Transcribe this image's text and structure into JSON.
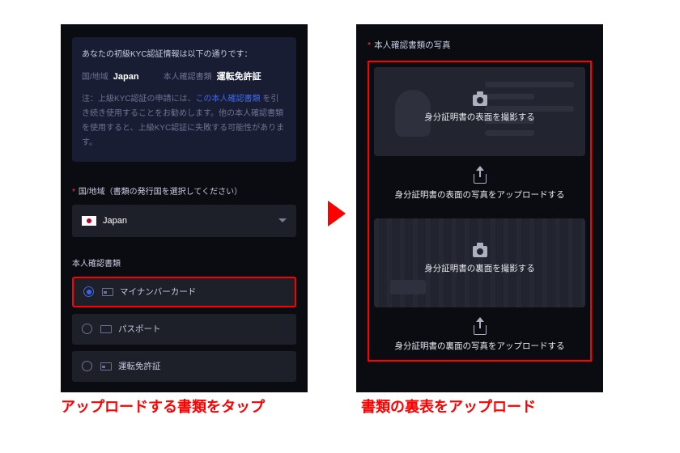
{
  "left": {
    "info": {
      "title": "あなたの初級KYC認証情報は以下の通りです：",
      "country_label": "国/地域",
      "country_value": "Japan",
      "doc_label": "本人確認書類",
      "doc_value": "運転免許証",
      "warn_prefix": "注：上級KYC認証の申請には、",
      "warn_link": "この本人確認書類",
      "warn_suffix": " を引き続き使用することをお勧めします。他の本人確認書類を使用すると、上級KYC認証に失敗する可能性があります。"
    },
    "region": {
      "label": "国/地域（書類の発行国を選択してください）",
      "value": "Japan"
    },
    "docs": {
      "label": "本人確認書類",
      "options": [
        {
          "label": "マイナンバーカード",
          "selected": true
        },
        {
          "label": "パスポート",
          "selected": false
        },
        {
          "label": "運転免許証",
          "selected": false
        }
      ]
    }
  },
  "right": {
    "title": "本人確認書類の写真",
    "front_shoot": "身分証明書の表面を撮影する",
    "front_upload": "身分証明書の表面の写真をアップロードする",
    "back_shoot": "身分証明書の裏面を撮影する",
    "back_upload": "身分証明書の裏面の写真をアップロードする"
  },
  "captions": {
    "left": "アップロードする書類をタップ",
    "right": "書類の裏表をアップロード"
  }
}
